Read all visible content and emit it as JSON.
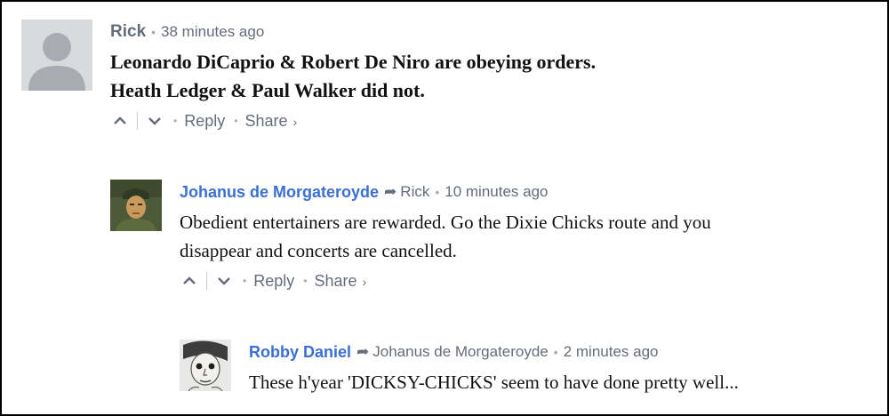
{
  "comments": [
    {
      "author": "Rick",
      "time": "38 minutes ago",
      "lines": [
        "Leonardo DiCaprio & Robert De Niro are obeying orders.",
        "Heath Ledger & Paul Walker did not."
      ]
    },
    {
      "author": "Johanus de Morgateroyde",
      "reply_to": "Rick",
      "time": "10 minutes ago",
      "lines": [
        "Obedient entertainers are rewarded. Go the Dixie Chicks route and you",
        "disappear and concerts are cancelled."
      ]
    },
    {
      "author": "Robby Daniel",
      "reply_to": "Johanus de Morgateroyde",
      "time": "2 minutes ago",
      "lines": [
        "These h'year 'DICKSY-CHICKS' seem to have done pretty well..."
      ]
    }
  ],
  "actions": {
    "reply": "Reply",
    "share": "Share",
    "share_chevron": "›",
    "bullet": "•",
    "reply_arrow": "➦"
  },
  "icons": {
    "upvote": "chevron-up-icon",
    "downvote": "chevron-down-icon",
    "reply_to": "reply-arrow-icon",
    "default_avatar": "default-user-avatar"
  },
  "colors": {
    "link": "#3b6fd4",
    "muted": "#656c7a",
    "text": "#111111"
  }
}
